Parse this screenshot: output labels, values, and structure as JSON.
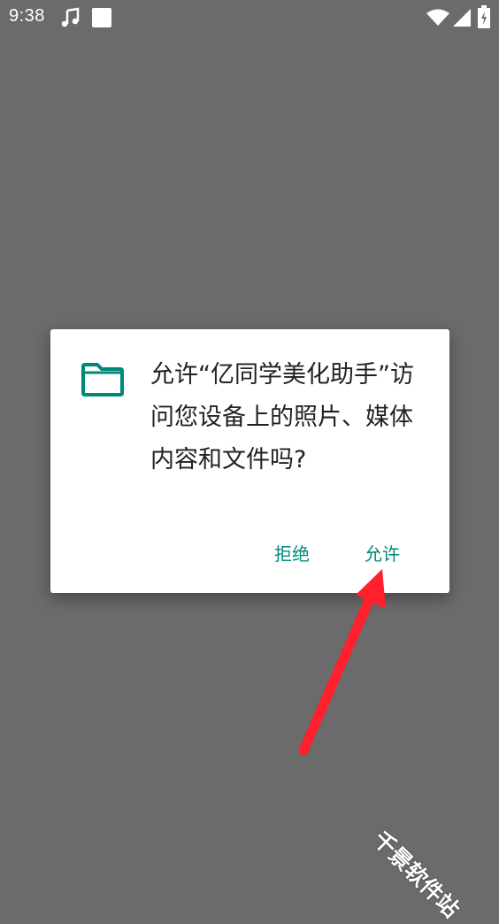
{
  "status_bar": {
    "time": "9:38",
    "left_icons": [
      "music-note-icon",
      "square-notification-icon"
    ],
    "right_icons": [
      "wifi-icon",
      "cell-signal-icon",
      "battery-charging-icon"
    ]
  },
  "dialog": {
    "icon": "folder-icon",
    "message": "允许“亿同学美化助手”访问您设备上的照片、媒体内容和文件吗?",
    "deny_label": "拒绝",
    "allow_label": "允许"
  },
  "watermark": "千景软件站",
  "colors": {
    "scrim": "#6b6b6b",
    "accent": "#00897b",
    "arrow": "#ff1f2d"
  }
}
